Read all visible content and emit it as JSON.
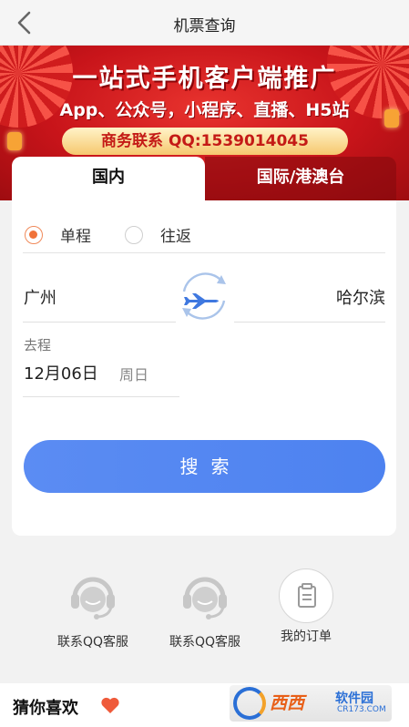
{
  "header": {
    "title": "机票查询",
    "back_icon": "chevron-left-icon"
  },
  "banner": {
    "line1": "一站式手机客户端推广",
    "line2": "App、公众号，小程序、直播、H5站",
    "contact": "商务联系 QQ:1539014045"
  },
  "tabs": [
    {
      "label": "国内",
      "active": true
    },
    {
      "label": "国际/港澳台",
      "active": false
    }
  ],
  "trip_type": {
    "oneway_label": "单程",
    "roundtrip_label": "往返",
    "selected": "单程"
  },
  "route": {
    "from_city": "广州",
    "to_city": "哈尔滨",
    "swap_icon": "plane-swap-icon"
  },
  "departure": {
    "label": "去程",
    "date": "12月06日",
    "weekday": "周日"
  },
  "search_button": {
    "label": "搜索"
  },
  "services": [
    {
      "label": "联系QQ客服",
      "icon": "customer-service-icon"
    },
    {
      "label": "联系QQ客服",
      "icon": "customer-service-icon"
    },
    {
      "label": "我的订单",
      "icon": "clipboard-icon"
    }
  ],
  "guess": {
    "title": "猜你喜欢",
    "icon": "heart-icon"
  },
  "watermark": {
    "brand": "西西",
    "sub": "软件园",
    "url": "CR173.COM"
  },
  "colors": {
    "accent_blue": "#4d82f0",
    "radio_orange": "#f0733a",
    "banner_red": "#c8141a"
  }
}
